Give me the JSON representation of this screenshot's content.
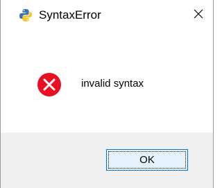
{
  "window": {
    "title": "SyntaxError",
    "app_icon": "python-icon",
    "close_icon": "close-icon"
  },
  "message": {
    "icon": "error-icon",
    "text": "invalid syntax"
  },
  "buttons": {
    "ok_label": "OK"
  },
  "colors": {
    "error_red": "#e81123",
    "button_border": "#0078d7",
    "button_fill": "#e5f1fb",
    "footer_bg": "#f0f0f0"
  }
}
